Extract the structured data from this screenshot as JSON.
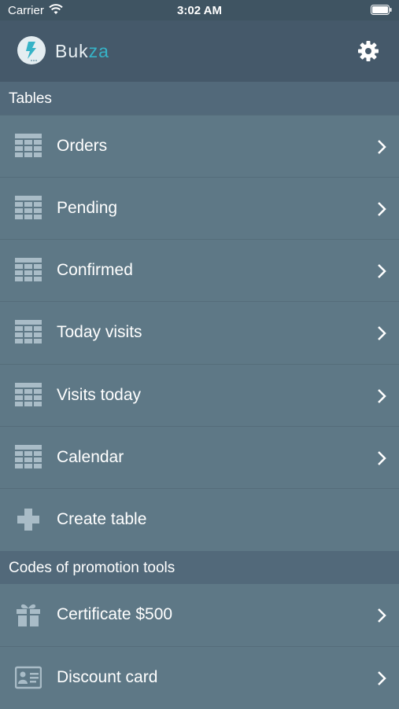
{
  "status_bar": {
    "carrier": "Carrier",
    "time": "3:02 AM"
  },
  "header": {
    "title_main": "Buk",
    "title_accent": "za"
  },
  "sections": {
    "tables": {
      "title": "Tables",
      "items": [
        {
          "label": "Orders",
          "icon": "table-icon"
        },
        {
          "label": "Pending",
          "icon": "table-icon"
        },
        {
          "label": "Confirmed",
          "icon": "table-icon"
        },
        {
          "label": "Today visits",
          "icon": "table-icon"
        },
        {
          "label": "Visits today",
          "icon": "table-icon"
        },
        {
          "label": "Calendar",
          "icon": "table-icon"
        },
        {
          "label": "Create table",
          "icon": "plus-icon"
        }
      ]
    },
    "promo": {
      "title": "Codes of promotion tools",
      "items": [
        {
          "label": "Certificate $500",
          "icon": "gift-icon"
        },
        {
          "label": "Discount card",
          "icon": "id-card-icon"
        }
      ]
    }
  },
  "colors": {
    "accent": "#36b3c7",
    "icon": "#a9bcc7"
  }
}
